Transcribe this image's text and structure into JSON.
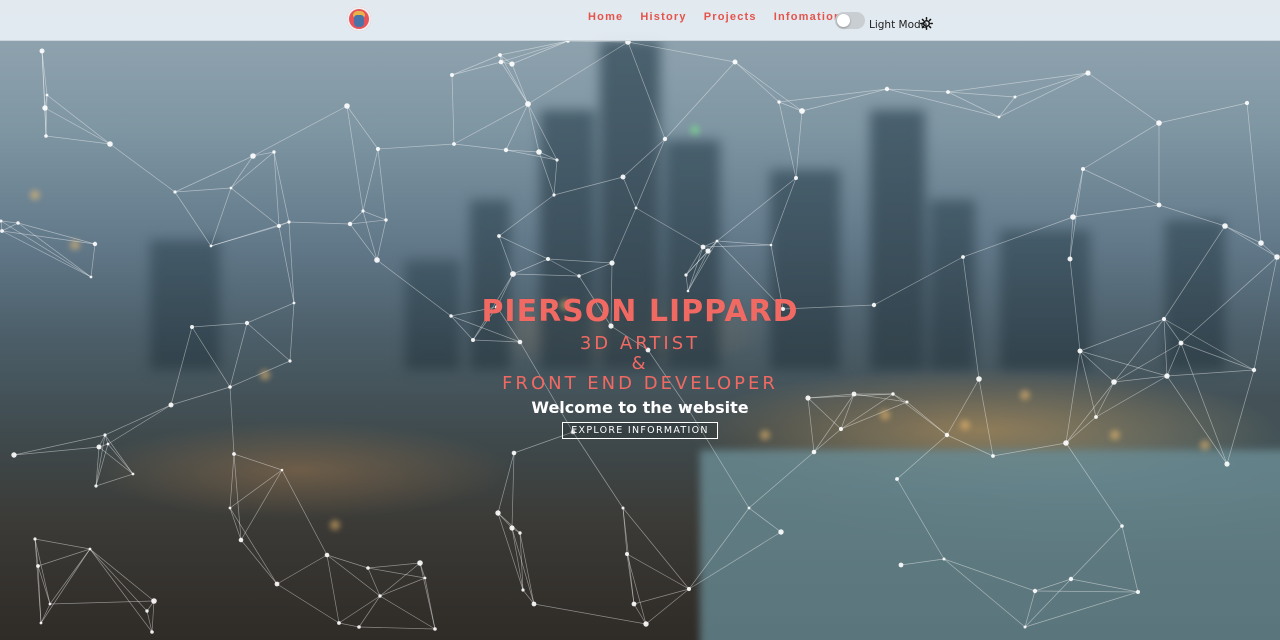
{
  "nav": {
    "links": [
      {
        "label": "Home"
      },
      {
        "label": "History"
      },
      {
        "label": "Projects"
      },
      {
        "label": "Infomation"
      }
    ],
    "mode_label": "Light Mode"
  },
  "hero": {
    "name": "PIERSON LIPPARD",
    "role_line1": "3D ARTIST",
    "role_amp": "&",
    "role_line2": "FRONT END DEVELOPER",
    "welcome": "Welcome to the website",
    "button_label": "EXPLORE INFORMATION"
  },
  "colors": {
    "accent": "#e5534b",
    "nav_bg": "#e8f0f5",
    "network": "#ffffff"
  },
  "icons": {
    "logo": "avatar-logo-icon",
    "mode": "sun-icon"
  }
}
